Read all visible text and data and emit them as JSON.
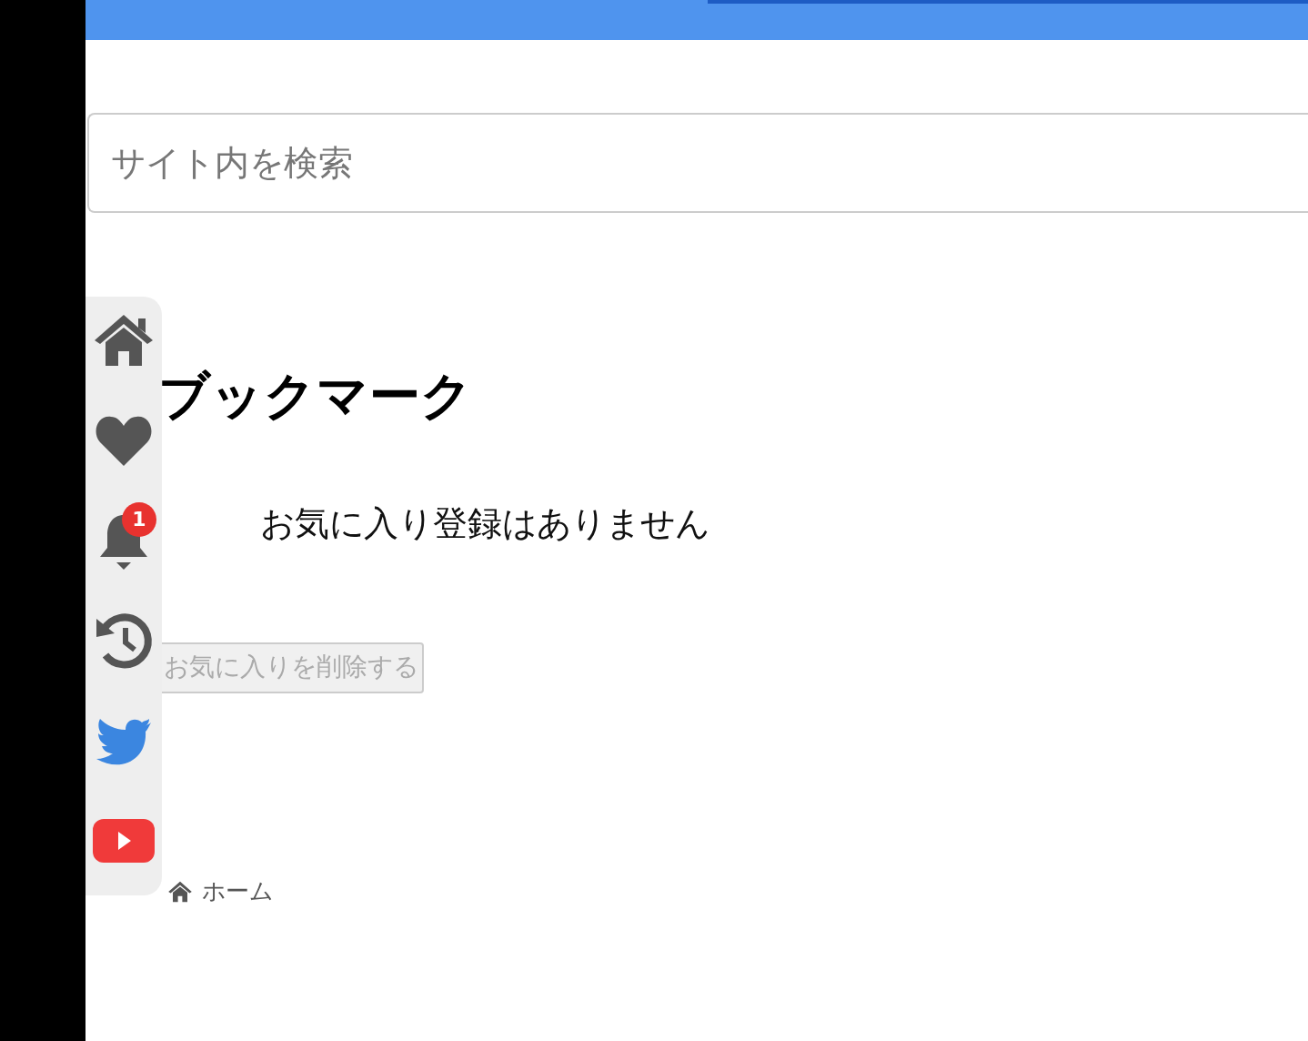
{
  "search": {
    "placeholder": "サイト内を検索"
  },
  "sidebar": {
    "items": [
      {
        "kind": "home"
      },
      {
        "kind": "heart"
      },
      {
        "kind": "bell",
        "badge": "1"
      },
      {
        "kind": "history"
      },
      {
        "kind": "bird"
      },
      {
        "kind": "play"
      }
    ]
  },
  "title": "ブックマーク",
  "message": "お気に入り登録はありません",
  "delete_button": {
    "label": "お気に入りを削除する",
    "disabled": true
  },
  "breadcrumb": {
    "label": "ホーム"
  }
}
